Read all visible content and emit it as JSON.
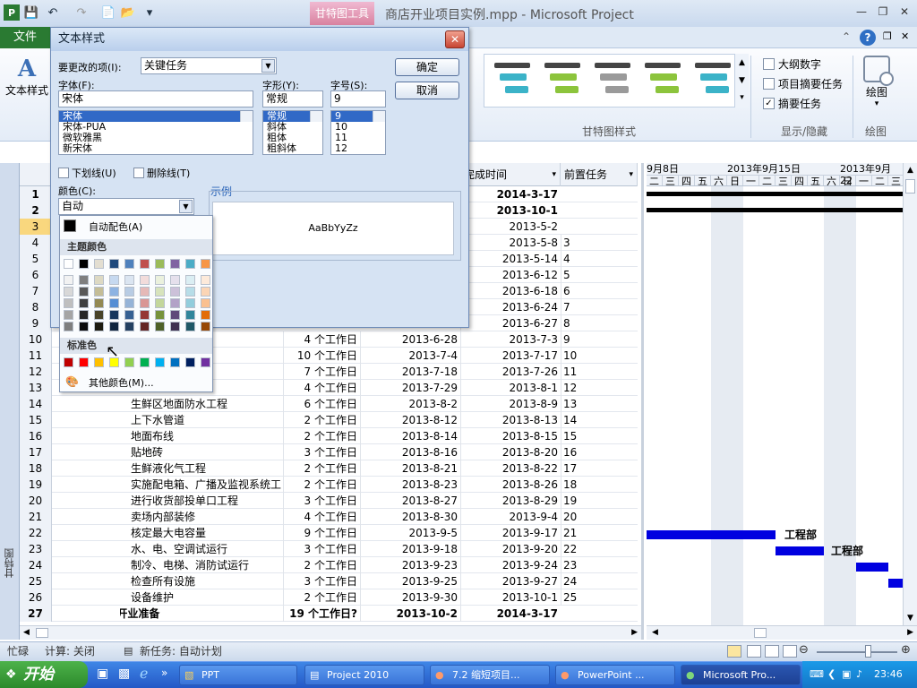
{
  "window": {
    "title": "商店开业项目实例.mpp - Microsoft Project",
    "context_tab": "甘特图工具",
    "file_tab": "文件"
  },
  "ribbon": {
    "text_style_label": "文本样式",
    "gantt_style_group": "甘特图样式",
    "show_hide_group": "显示/隐藏",
    "drawing_group": "绘图",
    "drawing_button": "绘图",
    "checkboxes": [
      {
        "label": "大纲数字",
        "checked": false
      },
      {
        "label": "项目摘要任务",
        "checked": false
      },
      {
        "label": "摘要任务",
        "checked": true
      }
    ],
    "gallery_colors": [
      "#3bb3c8",
      "#8cc43c",
      "#9a9a9a",
      "#8cc43c",
      "#3bb3c8"
    ]
  },
  "dialog": {
    "title": "文本样式",
    "item_label": "要更改的项(I):",
    "item_value": "关键任务",
    "font_label": "字体(F):",
    "font_value": "宋体",
    "font_list": [
      "宋体",
      "宋体-PUA",
      "微软雅黑",
      "新宋体"
    ],
    "style_label": "字形(Y):",
    "style_value": "常规",
    "style_list": [
      "常规",
      "斜体",
      "粗体",
      "粗斜体"
    ],
    "size_label": "字号(S):",
    "size_value": "9",
    "size_list": [
      "9",
      "10",
      "11",
      "12"
    ],
    "ok": "确定",
    "cancel": "取消",
    "underline": "下划线(U)",
    "strikethrough": "删除线(T)",
    "color_label": "颜色(C):",
    "color_value": "自动",
    "sample_label": "示例",
    "sample_text": "AaBbYyZz"
  },
  "color_popup": {
    "auto": "自动配色(A)",
    "theme_header": "主题颜色",
    "standard_header": "标准色",
    "more": "其他颜色(M)...",
    "theme_top": [
      "#ffffff",
      "#000000",
      "#e3ded1",
      "#1f497d",
      "#4f81bd",
      "#c0504d",
      "#9bbb59",
      "#8064a2",
      "#4bacc6",
      "#f79646"
    ],
    "theme_shades": [
      [
        "#f2f2f2",
        "#7f7f7f",
        "#ddd9c3",
        "#c6d9f0",
        "#dbe5f1",
        "#f2dcdb",
        "#ebf1dd",
        "#e5e0ec",
        "#dbeef3",
        "#fdeada"
      ],
      [
        "#d8d8d8",
        "#595959",
        "#c4bd97",
        "#8db3e2",
        "#b8cce4",
        "#e5b9b7",
        "#d7e3bc",
        "#ccc1d9",
        "#b7dde8",
        "#fbd5b5"
      ],
      [
        "#bfbfbf",
        "#3f3f3f",
        "#938953",
        "#548dd4",
        "#95b3d7",
        "#d99694",
        "#c3d69b",
        "#b2a2c7",
        "#92cddc",
        "#fac08f"
      ],
      [
        "#a5a5a5",
        "#262626",
        "#494429",
        "#17365d",
        "#366092",
        "#953734",
        "#76923c",
        "#5f497a",
        "#31859b",
        "#e36c09"
      ],
      [
        "#7f7f7f",
        "#0c0c0c",
        "#1d1b10",
        "#0f243e",
        "#244061",
        "#632423",
        "#4f6128",
        "#3f3151",
        "#205867",
        "#974806"
      ]
    ],
    "standard": [
      "#c00000",
      "#ff0000",
      "#ffc000",
      "#ffff00",
      "#92d050",
      "#00b050",
      "#00b0f0",
      "#0070c0",
      "#002060",
      "#7030a0"
    ]
  },
  "table": {
    "headers": {
      "finish": "完成时间",
      "pred": "前置任务"
    },
    "rows": [
      {
        "id": "1",
        "name": "",
        "dur": "",
        "start": "",
        "finish": "2014-3-17",
        "pred": "",
        "bold": true
      },
      {
        "id": "2",
        "name": "",
        "dur": "",
        "start": "",
        "finish": "2013-10-1",
        "pred": "",
        "bold": true
      },
      {
        "id": "3",
        "name": "",
        "dur": "",
        "start": "",
        "finish": "2013-5-2",
        "pred": ""
      },
      {
        "id": "4",
        "name": "",
        "dur": "",
        "start": "",
        "finish": "2013-5-8",
        "pred": "3"
      },
      {
        "id": "5",
        "name": "",
        "dur": "",
        "start": "",
        "finish": "2013-5-14",
        "pred": "4"
      },
      {
        "id": "6",
        "name": "",
        "dur": "",
        "start": "",
        "finish": "2013-6-12",
        "pred": "5"
      },
      {
        "id": "7",
        "name": "",
        "dur": "",
        "start": "",
        "finish": "2013-6-18",
        "pred": "6"
      },
      {
        "id": "8",
        "name": "",
        "dur": "",
        "start": "",
        "finish": "2013-6-24",
        "pred": "7"
      },
      {
        "id": "9",
        "name": "",
        "dur": "",
        "start": "",
        "finish": "2013-6-27",
        "pred": "8"
      },
      {
        "id": "10",
        "name": "",
        "dur": "4 个工作日",
        "start": "2013-6-28",
        "finish": "2013-7-3",
        "pred": "9"
      },
      {
        "id": "11",
        "name": "",
        "dur": "10 个工作日",
        "start": "2013-7-4",
        "finish": "2013-7-17",
        "pred": "10"
      },
      {
        "id": "12",
        "name": "",
        "dur": "7 个工作日",
        "start": "2013-7-18",
        "finish": "2013-7-26",
        "pred": "11"
      },
      {
        "id": "13",
        "name": "",
        "dur": "4 个工作日",
        "start": "2013-7-29",
        "finish": "2013-8-1",
        "pred": "12"
      },
      {
        "id": "14",
        "name": "生鲜区地面防水工程",
        "dur": "6 个工作日",
        "start": "2013-8-2",
        "finish": "2013-8-9",
        "pred": "13"
      },
      {
        "id": "15",
        "name": "上下水管道",
        "dur": "2 个工作日",
        "start": "2013-8-12",
        "finish": "2013-8-13",
        "pred": "14"
      },
      {
        "id": "16",
        "name": "地面布线",
        "dur": "2 个工作日",
        "start": "2013-8-14",
        "finish": "2013-8-15",
        "pred": "15"
      },
      {
        "id": "17",
        "name": "贴地砖",
        "dur": "3 个工作日",
        "start": "2013-8-16",
        "finish": "2013-8-20",
        "pred": "16"
      },
      {
        "id": "18",
        "name": "生鲜液化气工程",
        "dur": "2 个工作日",
        "start": "2013-8-21",
        "finish": "2013-8-22",
        "pred": "17"
      },
      {
        "id": "19",
        "name": "实施配电箱、广播及监视系统工",
        "dur": "2 个工作日",
        "start": "2013-8-23",
        "finish": "2013-8-26",
        "pred": "18"
      },
      {
        "id": "20",
        "name": "进行收货部投单口工程",
        "dur": "3 个工作日",
        "start": "2013-8-27",
        "finish": "2013-8-29",
        "pred": "19"
      },
      {
        "id": "21",
        "name": "卖场内部装修",
        "dur": "4 个工作日",
        "start": "2013-8-30",
        "finish": "2013-9-4",
        "pred": "20"
      },
      {
        "id": "22",
        "name": "核定最大电容量",
        "dur": "9 个工作日",
        "start": "2013-9-5",
        "finish": "2013-9-17",
        "pred": "21"
      },
      {
        "id": "23",
        "name": "水、电、空调试运行",
        "dur": "3 个工作日",
        "start": "2013-9-18",
        "finish": "2013-9-20",
        "pred": "22"
      },
      {
        "id": "24",
        "name": "制冷、电梯、消防试运行",
        "dur": "2 个工作日",
        "start": "2013-9-23",
        "finish": "2013-9-24",
        "pred": "23"
      },
      {
        "id": "25",
        "name": "检查所有设施",
        "dur": "3 个工作日",
        "start": "2013-9-25",
        "finish": "2013-9-27",
        "pred": "24"
      },
      {
        "id": "26",
        "name": "设备维护",
        "dur": "2 个工作日",
        "start": "2013-9-30",
        "finish": "2013-10-1",
        "pred": "25"
      },
      {
        "id": "27",
        "name": "开业准备",
        "dur": "19 个工作日?",
        "start": "2013-10-2",
        "finish": "2014-3-17",
        "pred": "",
        "bold": true,
        "summary": true
      }
    ]
  },
  "chart": {
    "weeks": [
      "9月8日",
      "2013年9月15日",
      "2013年9月22"
    ],
    "days": [
      "二",
      "三",
      "四",
      "五",
      "六",
      "日",
      "一",
      "二",
      "三",
      "四",
      "五",
      "六",
      "日",
      "一",
      "二",
      "三"
    ],
    "labels": [
      "工程部",
      "工程部"
    ]
  },
  "sidebar_label": "甘特图",
  "status": {
    "ready": "忙碌",
    "calc": "计算: 关闭",
    "newtask": "新任务: 自动计划"
  },
  "taskbar": {
    "start": "开始",
    "buttons": [
      "PPT",
      "Project 2010",
      "7.2 缩短项目...",
      "PowerPoint ...",
      "Microsoft Pro..."
    ],
    "time": "23:46"
  }
}
